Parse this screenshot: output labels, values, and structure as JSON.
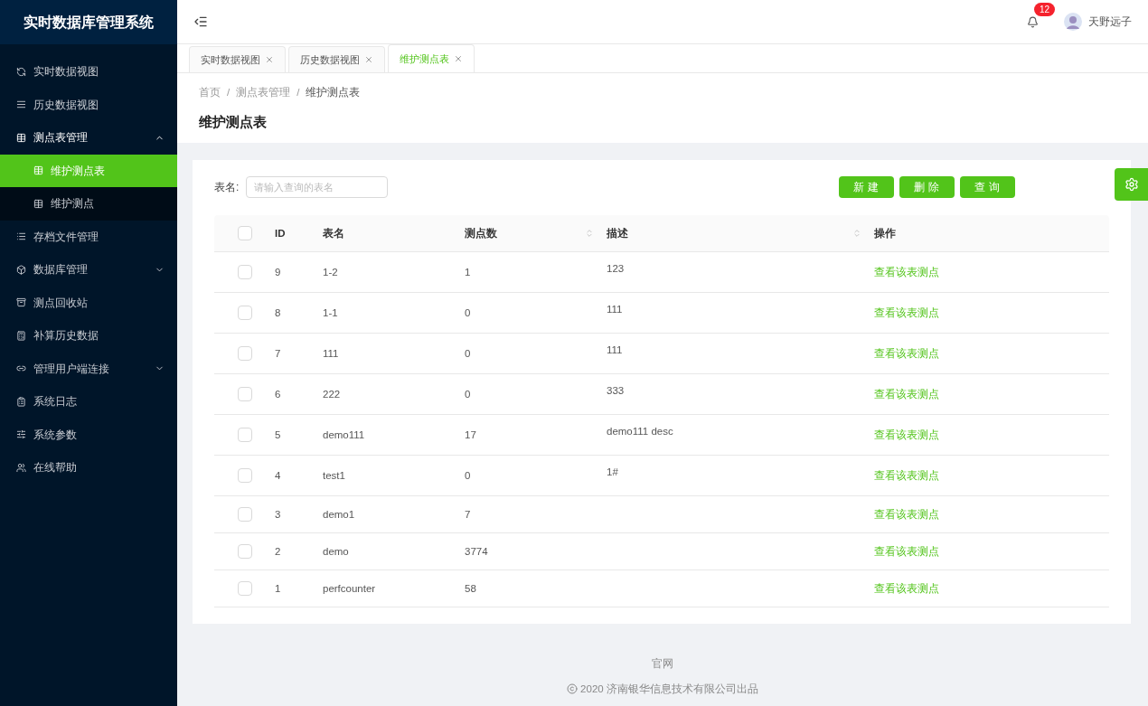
{
  "app_title": "实时数据库管理系统",
  "sidebar": {
    "items": [
      {
        "label": "实时数据视图",
        "selected": false
      },
      {
        "label": "历史数据视图",
        "selected": false
      },
      {
        "label": "测点表管理",
        "selected": false,
        "expanded": true,
        "children": [
          {
            "label": "维护测点表",
            "selected": true
          },
          {
            "label": "维护测点",
            "selected": false
          }
        ]
      },
      {
        "label": "存档文件管理",
        "selected": false
      },
      {
        "label": "数据库管理",
        "selected": false,
        "expanded": false
      },
      {
        "label": "测点回收站",
        "selected": false
      },
      {
        "label": "补算历史数据",
        "selected": false
      },
      {
        "label": "管理用户端连接",
        "selected": false,
        "expanded": false
      },
      {
        "label": "系统日志",
        "selected": false
      },
      {
        "label": "系统参数",
        "selected": false
      },
      {
        "label": "在线帮助",
        "selected": false
      }
    ]
  },
  "header": {
    "notification_count": "12",
    "user_name": "天野远子"
  },
  "tabs": [
    {
      "label": "实时数据视图",
      "selected": false
    },
    {
      "label": "历史数据视图",
      "selected": false
    },
    {
      "label": "维护测点表",
      "selected": true
    }
  ],
  "breadcrumb": {
    "separator": "/",
    "items": [
      "首页",
      "测点表管理",
      "维护测点表"
    ]
  },
  "page_title": "维护测点表",
  "search": {
    "label": "表名:",
    "placeholder": "请输入查询的表名"
  },
  "buttons": [
    "新建",
    "删除",
    "查询"
  ],
  "table": {
    "header_checked": false,
    "columns": [
      {
        "label": "ID",
        "sortable": false
      },
      {
        "label": "表名",
        "sortable": false
      },
      {
        "label": "测点数",
        "sortable": true
      },
      {
        "label": "描述",
        "sortable": true
      },
      {
        "label": "操作",
        "sortable": false
      }
    ],
    "rows": [
      {
        "checked": false,
        "id": "9",
        "name": "1-2",
        "count": "1",
        "description": "123",
        "action": "查看该表测点"
      },
      {
        "checked": false,
        "id": "8",
        "name": "1-1",
        "count": "0",
        "description": "111",
        "action": "查看该表测点"
      },
      {
        "checked": false,
        "id": "7",
        "name": "111",
        "count": "0",
        "description": "111",
        "action": "查看该表测点"
      },
      {
        "checked": false,
        "id": "6",
        "name": "222",
        "count": "0",
        "description": "333",
        "action": "查看该表测点"
      },
      {
        "checked": false,
        "id": "5",
        "name": "demo111",
        "count": "17",
        "description": "demo111 desc",
        "action": "查看该表测点"
      },
      {
        "checked": false,
        "id": "4",
        "name": "test1",
        "count": "0",
        "description": "1#",
        "action": "查看该表测点"
      },
      {
        "checked": false,
        "id": "3",
        "name": "demo1",
        "count": "7",
        "action": "查看该表测点"
      },
      {
        "checked": false,
        "id": "2",
        "name": "demo",
        "count": "3774",
        "action": "查看该表测点"
      },
      {
        "checked": false,
        "id": "1",
        "name": "perfcounter",
        "count": "58",
        "action": "查看该表测点"
      }
    ]
  },
  "footer": {
    "link": "官网",
    "copyright": "2020 济南银华信息技术有限公司出品"
  }
}
